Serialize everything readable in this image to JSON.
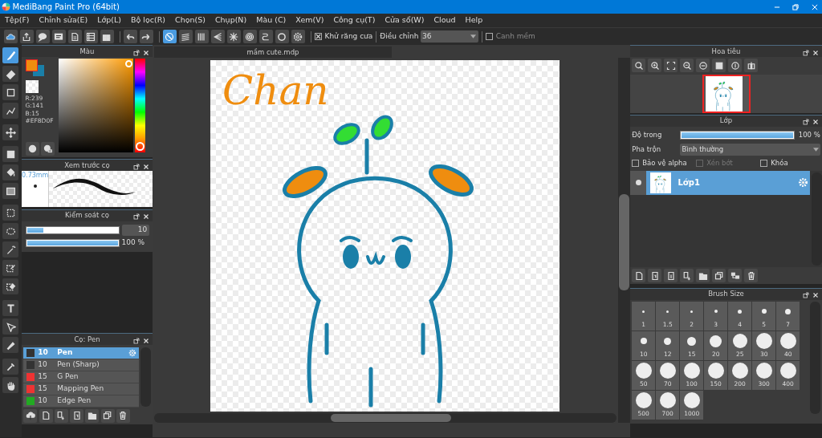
{
  "window": {
    "title": "MediBang Paint Pro (64bit)"
  },
  "menu": [
    "Tệp(F)",
    "Chỉnh sửa(E)",
    "Lớp(L)",
    "Bộ lọc(R)",
    "Chọn(S)",
    "Chụp(N)",
    "Màu (C)",
    "Xem(V)",
    "Công cụ(T)",
    "Cửa sổ(W)",
    "Cloud",
    "Help"
  ],
  "toolbar": {
    "snaps": [
      {
        "kind": "none",
        "selected": true
      },
      {
        "kind": "parallel",
        "selected": false
      },
      {
        "kind": "cross",
        "selected": false
      },
      {
        "kind": "vanishing",
        "selected": false
      },
      {
        "kind": "radial",
        "selected": false
      },
      {
        "kind": "concentric",
        "selected": false
      },
      {
        "kind": "curve",
        "selected": false
      },
      {
        "kind": "circle",
        "selected": false
      },
      {
        "kind": "settings",
        "selected": false
      }
    ],
    "antialias": {
      "label": "Khử răng cưa",
      "checked": true
    },
    "correction": {
      "label": "Điều chỉnh",
      "value": "36"
    },
    "soft_edge": {
      "label": "Canh mềm",
      "checked": false
    }
  },
  "tools": [
    {
      "kind": "brush",
      "selected": true
    },
    {
      "kind": "eraser",
      "selected": false
    },
    {
      "kind": "shape",
      "selected": false
    },
    {
      "kind": "vector",
      "selected": false
    },
    {
      "kind": "move",
      "selected": false
    },
    {
      "kind": "fill",
      "selected": false
    },
    {
      "kind": "bucket",
      "selected": false
    },
    {
      "kind": "gradient",
      "selected": false
    },
    {
      "kind": "select",
      "selected": false
    },
    {
      "kind": "lasso",
      "selected": false
    },
    {
      "kind": "wand",
      "selected": false
    },
    {
      "kind": "selpen",
      "selected": false
    },
    {
      "kind": "seleraser",
      "selected": false
    },
    {
      "kind": "text",
      "selected": false
    },
    {
      "kind": "operation",
      "selected": false
    },
    {
      "kind": "divide",
      "selected": false
    },
    {
      "kind": "dropper",
      "selected": false
    },
    {
      "kind": "hand",
      "selected": false
    }
  ],
  "color_panel": {
    "title": "Màu",
    "r": "R:239",
    "g": "G:141",
    "b": "B:15",
    "hex": "#EF8D0F"
  },
  "brush_preview": {
    "title": "Xem trước cọ",
    "size": "0.73mm"
  },
  "brush_control": {
    "title": "Kiểm soát cọ",
    "sliders": [
      {
        "kind": "boxed",
        "level": 0.18,
        "reading": "10"
      },
      {
        "kind": "plain",
        "level": 1,
        "reading": "100 %"
      }
    ]
  },
  "brushes": {
    "title": "Cọ: Pen",
    "items": [
      {
        "size": "10",
        "name": "Pen",
        "color": "#333333",
        "selected": true
      },
      {
        "size": "10",
        "name": "Pen (Sharp)",
        "color": "#333333",
        "selected": false
      },
      {
        "size": "15",
        "name": "G Pen",
        "color": "#ee3333",
        "selected": false
      },
      {
        "size": "15",
        "name": "Mapping Pen",
        "color": "#ee3333",
        "selected": false
      },
      {
        "size": "10",
        "name": "Edge Pen",
        "color": "#22aa22",
        "selected": false
      }
    ]
  },
  "document": {
    "tab": "mầm cute.mdp",
    "drawing_text": "Chan"
  },
  "navigator": {
    "title": "Hoa tiêu"
  },
  "layers": {
    "title": "Lớp",
    "opacity_label": "Độ trong",
    "opacity": {
      "level": 1,
      "reading": "100 %"
    },
    "blend_label": "Pha trộn",
    "blend": "Bình thường",
    "options": [
      {
        "label": "Bảo vệ alpha",
        "checked": false,
        "disabled": false
      },
      {
        "label": "Xén bớt",
        "checked": false,
        "disabled": true
      },
      {
        "label": "Khóa",
        "checked": false,
        "disabled": false
      }
    ],
    "items": [
      {
        "name": "Lớp1",
        "selected": true,
        "visible": true
      }
    ]
  },
  "brush_size": {
    "title": "Brush Size",
    "sizes": [
      "1",
      "1.5",
      "2",
      "3",
      "4",
      "5",
      "7",
      "10",
      "12",
      "15",
      "20",
      "25",
      "30",
      "40",
      "50",
      "70",
      "100",
      "150",
      "200",
      "300",
      "400",
      "500",
      "700",
      "1000"
    ]
  }
}
